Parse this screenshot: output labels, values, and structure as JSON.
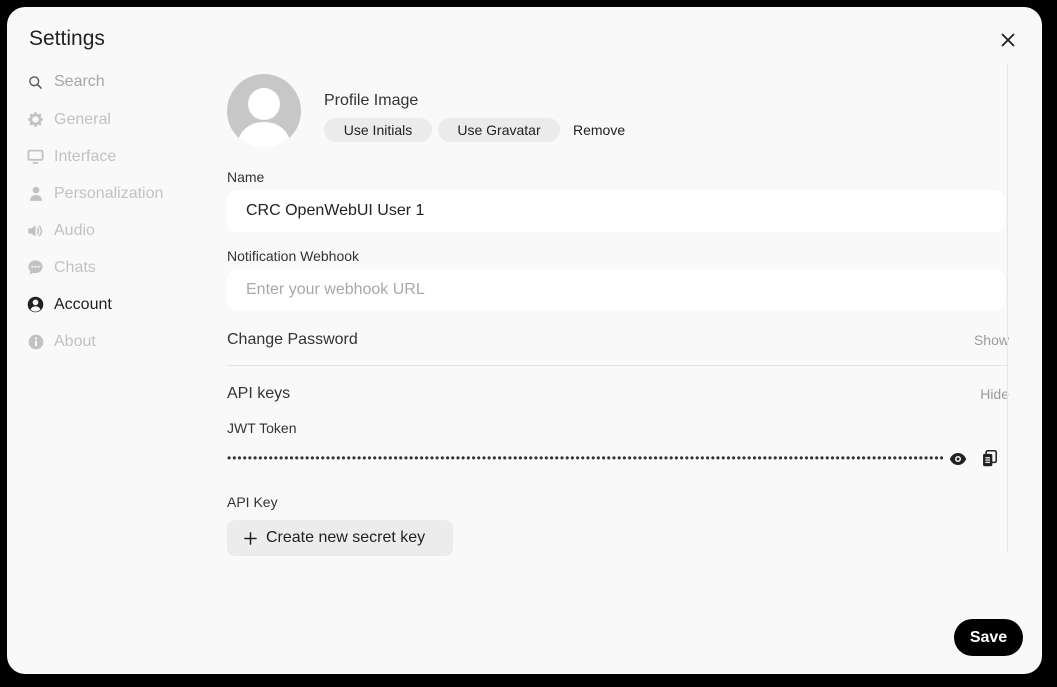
{
  "modal": {
    "title": "Settings"
  },
  "sidebar": {
    "search_label": "Search",
    "items": [
      {
        "label": "General",
        "icon": "gear-icon"
      },
      {
        "label": "Interface",
        "icon": "monitor-icon"
      },
      {
        "label": "Personalization",
        "icon": "person-icon"
      },
      {
        "label": "Audio",
        "icon": "speaker-icon"
      },
      {
        "label": "Chats",
        "icon": "chat-bubble-icon"
      },
      {
        "label": "Account",
        "icon": "account-circle-icon",
        "active": true
      },
      {
        "label": "About",
        "icon": "info-icon"
      }
    ]
  },
  "profile": {
    "label": "Profile Image",
    "use_initials": "Use Initials",
    "use_gravatar": "Use Gravatar",
    "remove": "Remove"
  },
  "name_field": {
    "label": "Name",
    "value": "CRC OpenWebUI User 1"
  },
  "webhook_field": {
    "label": "Notification Webhook",
    "value": "",
    "placeholder": "Enter your webhook URL"
  },
  "change_password": {
    "label": "Change Password",
    "toggle": "Show"
  },
  "api_keys": {
    "label": "API keys",
    "toggle": "Hide",
    "jwt_label": "JWT Token",
    "jwt_masked": "••••••••••••••••••••••••••••••••••••••••••••••••••••••••••••••••••••••••••••••••••••••••••••••••••••••••••••••••••••••••••••••••••••••••••••••••••••••",
    "api_key_label": "API Key",
    "create_button": "Create new secret key"
  },
  "footer": {
    "save": "Save"
  },
  "colors": {
    "accent": "#000000",
    "inactive_text": "#c2c2c2",
    "background": "#f9f9f9"
  }
}
